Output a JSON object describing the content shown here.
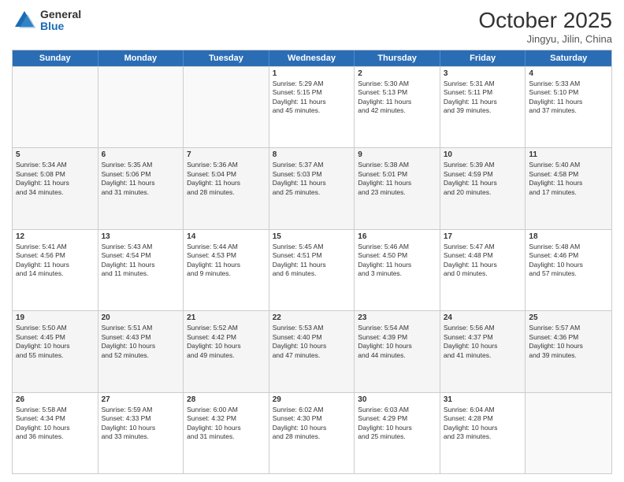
{
  "logo": {
    "general": "General",
    "blue": "Blue"
  },
  "title": "October 2025",
  "subtitle": "Jingyu, Jilin, China",
  "days": [
    "Sunday",
    "Monday",
    "Tuesday",
    "Wednesday",
    "Thursday",
    "Friday",
    "Saturday"
  ],
  "rows": [
    [
      {
        "day": "",
        "text": ""
      },
      {
        "day": "",
        "text": ""
      },
      {
        "day": "",
        "text": ""
      },
      {
        "day": "1",
        "text": "Sunrise: 5:29 AM\nSunset: 5:15 PM\nDaylight: 11 hours\nand 45 minutes."
      },
      {
        "day": "2",
        "text": "Sunrise: 5:30 AM\nSunset: 5:13 PM\nDaylight: 11 hours\nand 42 minutes."
      },
      {
        "day": "3",
        "text": "Sunrise: 5:31 AM\nSunset: 5:11 PM\nDaylight: 11 hours\nand 39 minutes."
      },
      {
        "day": "4",
        "text": "Sunrise: 5:33 AM\nSunset: 5:10 PM\nDaylight: 11 hours\nand 37 minutes."
      }
    ],
    [
      {
        "day": "5",
        "text": "Sunrise: 5:34 AM\nSunset: 5:08 PM\nDaylight: 11 hours\nand 34 minutes."
      },
      {
        "day": "6",
        "text": "Sunrise: 5:35 AM\nSunset: 5:06 PM\nDaylight: 11 hours\nand 31 minutes."
      },
      {
        "day": "7",
        "text": "Sunrise: 5:36 AM\nSunset: 5:04 PM\nDaylight: 11 hours\nand 28 minutes."
      },
      {
        "day": "8",
        "text": "Sunrise: 5:37 AM\nSunset: 5:03 PM\nDaylight: 11 hours\nand 25 minutes."
      },
      {
        "day": "9",
        "text": "Sunrise: 5:38 AM\nSunset: 5:01 PM\nDaylight: 11 hours\nand 23 minutes."
      },
      {
        "day": "10",
        "text": "Sunrise: 5:39 AM\nSunset: 4:59 PM\nDaylight: 11 hours\nand 20 minutes."
      },
      {
        "day": "11",
        "text": "Sunrise: 5:40 AM\nSunset: 4:58 PM\nDaylight: 11 hours\nand 17 minutes."
      }
    ],
    [
      {
        "day": "12",
        "text": "Sunrise: 5:41 AM\nSunset: 4:56 PM\nDaylight: 11 hours\nand 14 minutes."
      },
      {
        "day": "13",
        "text": "Sunrise: 5:43 AM\nSunset: 4:54 PM\nDaylight: 11 hours\nand 11 minutes."
      },
      {
        "day": "14",
        "text": "Sunrise: 5:44 AM\nSunset: 4:53 PM\nDaylight: 11 hours\nand 9 minutes."
      },
      {
        "day": "15",
        "text": "Sunrise: 5:45 AM\nSunset: 4:51 PM\nDaylight: 11 hours\nand 6 minutes."
      },
      {
        "day": "16",
        "text": "Sunrise: 5:46 AM\nSunset: 4:50 PM\nDaylight: 11 hours\nand 3 minutes."
      },
      {
        "day": "17",
        "text": "Sunrise: 5:47 AM\nSunset: 4:48 PM\nDaylight: 11 hours\nand 0 minutes."
      },
      {
        "day": "18",
        "text": "Sunrise: 5:48 AM\nSunset: 4:46 PM\nDaylight: 10 hours\nand 57 minutes."
      }
    ],
    [
      {
        "day": "19",
        "text": "Sunrise: 5:50 AM\nSunset: 4:45 PM\nDaylight: 10 hours\nand 55 minutes."
      },
      {
        "day": "20",
        "text": "Sunrise: 5:51 AM\nSunset: 4:43 PM\nDaylight: 10 hours\nand 52 minutes."
      },
      {
        "day": "21",
        "text": "Sunrise: 5:52 AM\nSunset: 4:42 PM\nDaylight: 10 hours\nand 49 minutes."
      },
      {
        "day": "22",
        "text": "Sunrise: 5:53 AM\nSunset: 4:40 PM\nDaylight: 10 hours\nand 47 minutes."
      },
      {
        "day": "23",
        "text": "Sunrise: 5:54 AM\nSunset: 4:39 PM\nDaylight: 10 hours\nand 44 minutes."
      },
      {
        "day": "24",
        "text": "Sunrise: 5:56 AM\nSunset: 4:37 PM\nDaylight: 10 hours\nand 41 minutes."
      },
      {
        "day": "25",
        "text": "Sunrise: 5:57 AM\nSunset: 4:36 PM\nDaylight: 10 hours\nand 39 minutes."
      }
    ],
    [
      {
        "day": "26",
        "text": "Sunrise: 5:58 AM\nSunset: 4:34 PM\nDaylight: 10 hours\nand 36 minutes."
      },
      {
        "day": "27",
        "text": "Sunrise: 5:59 AM\nSunset: 4:33 PM\nDaylight: 10 hours\nand 33 minutes."
      },
      {
        "day": "28",
        "text": "Sunrise: 6:00 AM\nSunset: 4:32 PM\nDaylight: 10 hours\nand 31 minutes."
      },
      {
        "day": "29",
        "text": "Sunrise: 6:02 AM\nSunset: 4:30 PM\nDaylight: 10 hours\nand 28 minutes."
      },
      {
        "day": "30",
        "text": "Sunrise: 6:03 AM\nSunset: 4:29 PM\nDaylight: 10 hours\nand 25 minutes."
      },
      {
        "day": "31",
        "text": "Sunrise: 6:04 AM\nSunset: 4:28 PM\nDaylight: 10 hours\nand 23 minutes."
      },
      {
        "day": "",
        "text": ""
      }
    ]
  ]
}
